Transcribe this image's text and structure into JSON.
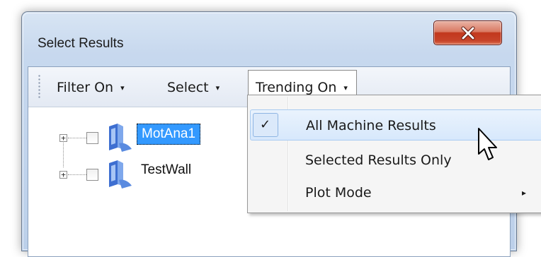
{
  "window": {
    "title": "Select Results",
    "close_icon": "close-x-icon"
  },
  "toolbar": {
    "filter_label": "Filter On",
    "select_label": "Select",
    "trending_label": "Trending On",
    "dropdown_arrow": "▾"
  },
  "tree": {
    "items": [
      {
        "label": "MotAna1",
        "expander": "+",
        "selected": true,
        "checked": false
      },
      {
        "label": "TestWall",
        "expander": "+",
        "selected": false,
        "checked": false
      }
    ]
  },
  "menu": {
    "items": [
      {
        "label": "All Machine Results",
        "checked": true,
        "check_glyph": "✓"
      },
      {
        "label": "Selected Results Only",
        "checked": false
      },
      {
        "label": "Plot Mode",
        "has_submenu": true,
        "submenu_glyph": "▸"
      }
    ]
  },
  "colors": {
    "selection": "#3399ff",
    "menu_hover": "#d7e8fc",
    "close_button": "#c7442a"
  }
}
